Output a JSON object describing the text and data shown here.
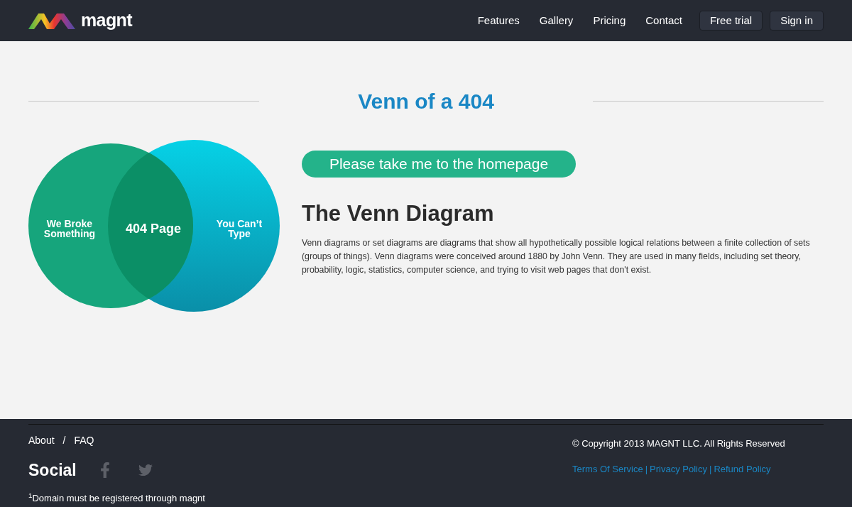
{
  "header": {
    "logo_text": "magnt",
    "nav": [
      "Features",
      "Gallery",
      "Pricing",
      "Contact"
    ],
    "buttons": [
      "Free trial",
      "Sign in"
    ]
  },
  "main": {
    "title": "Venn of a 404",
    "venn": {
      "left": [
        "We Broke",
        "Something"
      ],
      "center": "404 Page",
      "right": [
        "You Can’t",
        "Type"
      ]
    },
    "home_button": "Please take me to the homepage",
    "heading": "The Venn Diagram",
    "paragraph": "Venn diagrams or set diagrams are diagrams that show all hypothetically possible logical relations between a finite collection of sets (groups of things). Venn diagrams were conceived around 1880 by John Venn. They are used in many fields, including set theory, probability, logic, statistics, computer science, and trying to visit web pages that don't exist."
  },
  "footer": {
    "links": [
      "About",
      "FAQ"
    ],
    "link_separator": "/",
    "social_label": "Social",
    "footnote": "$^{1}$Domain must be registered through magnt",
    "copyright": "© Copyright 2013 MAGNT LLC. All Rights Reserved",
    "legal_links": [
      "Terms Of Service",
      "Privacy Policy",
      "Refund Policy"
    ],
    "legal_separator": "|"
  }
}
